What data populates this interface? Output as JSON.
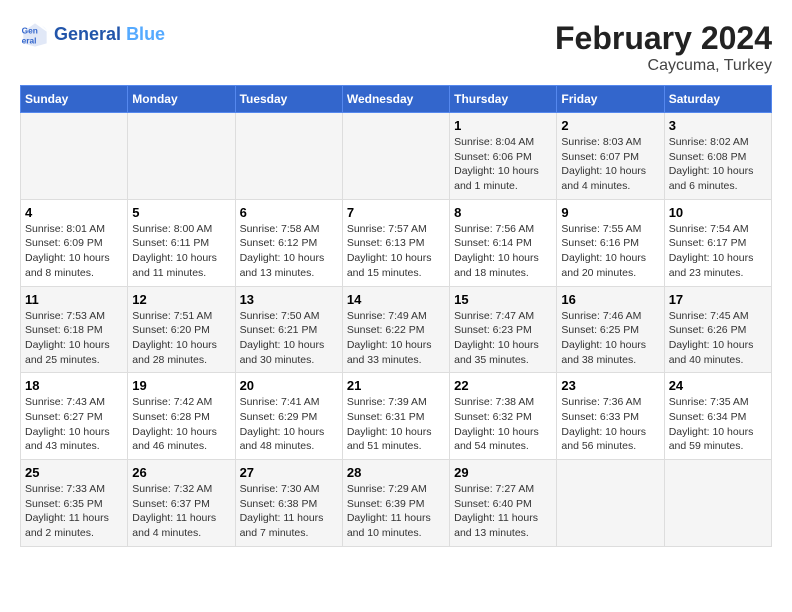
{
  "header": {
    "logo_line1": "General",
    "logo_line2": "Blue",
    "main_title": "February 2024",
    "subtitle": "Caycuma, Turkey"
  },
  "weekdays": [
    "Sunday",
    "Monday",
    "Tuesday",
    "Wednesday",
    "Thursday",
    "Friday",
    "Saturday"
  ],
  "weeks": [
    {
      "row_bg": "odd",
      "days": [
        {
          "num": "",
          "info": ""
        },
        {
          "num": "",
          "info": ""
        },
        {
          "num": "",
          "info": ""
        },
        {
          "num": "",
          "info": ""
        },
        {
          "num": "1",
          "info": "Sunrise: 8:04 AM\nSunset: 6:06 PM\nDaylight: 10 hours\nand 1 minute."
        },
        {
          "num": "2",
          "info": "Sunrise: 8:03 AM\nSunset: 6:07 PM\nDaylight: 10 hours\nand 4 minutes."
        },
        {
          "num": "3",
          "info": "Sunrise: 8:02 AM\nSunset: 6:08 PM\nDaylight: 10 hours\nand 6 minutes."
        }
      ]
    },
    {
      "row_bg": "even",
      "days": [
        {
          "num": "4",
          "info": "Sunrise: 8:01 AM\nSunset: 6:09 PM\nDaylight: 10 hours\nand 8 minutes."
        },
        {
          "num": "5",
          "info": "Sunrise: 8:00 AM\nSunset: 6:11 PM\nDaylight: 10 hours\nand 11 minutes."
        },
        {
          "num": "6",
          "info": "Sunrise: 7:58 AM\nSunset: 6:12 PM\nDaylight: 10 hours\nand 13 minutes."
        },
        {
          "num": "7",
          "info": "Sunrise: 7:57 AM\nSunset: 6:13 PM\nDaylight: 10 hours\nand 15 minutes."
        },
        {
          "num": "8",
          "info": "Sunrise: 7:56 AM\nSunset: 6:14 PM\nDaylight: 10 hours\nand 18 minutes."
        },
        {
          "num": "9",
          "info": "Sunrise: 7:55 AM\nSunset: 6:16 PM\nDaylight: 10 hours\nand 20 minutes."
        },
        {
          "num": "10",
          "info": "Sunrise: 7:54 AM\nSunset: 6:17 PM\nDaylight: 10 hours\nand 23 minutes."
        }
      ]
    },
    {
      "row_bg": "odd",
      "days": [
        {
          "num": "11",
          "info": "Sunrise: 7:53 AM\nSunset: 6:18 PM\nDaylight: 10 hours\nand 25 minutes."
        },
        {
          "num": "12",
          "info": "Sunrise: 7:51 AM\nSunset: 6:20 PM\nDaylight: 10 hours\nand 28 minutes."
        },
        {
          "num": "13",
          "info": "Sunrise: 7:50 AM\nSunset: 6:21 PM\nDaylight: 10 hours\nand 30 minutes."
        },
        {
          "num": "14",
          "info": "Sunrise: 7:49 AM\nSunset: 6:22 PM\nDaylight: 10 hours\nand 33 minutes."
        },
        {
          "num": "15",
          "info": "Sunrise: 7:47 AM\nSunset: 6:23 PM\nDaylight: 10 hours\nand 35 minutes."
        },
        {
          "num": "16",
          "info": "Sunrise: 7:46 AM\nSunset: 6:25 PM\nDaylight: 10 hours\nand 38 minutes."
        },
        {
          "num": "17",
          "info": "Sunrise: 7:45 AM\nSunset: 6:26 PM\nDaylight: 10 hours\nand 40 minutes."
        }
      ]
    },
    {
      "row_bg": "even",
      "days": [
        {
          "num": "18",
          "info": "Sunrise: 7:43 AM\nSunset: 6:27 PM\nDaylight: 10 hours\nand 43 minutes."
        },
        {
          "num": "19",
          "info": "Sunrise: 7:42 AM\nSunset: 6:28 PM\nDaylight: 10 hours\nand 46 minutes."
        },
        {
          "num": "20",
          "info": "Sunrise: 7:41 AM\nSunset: 6:29 PM\nDaylight: 10 hours\nand 48 minutes."
        },
        {
          "num": "21",
          "info": "Sunrise: 7:39 AM\nSunset: 6:31 PM\nDaylight: 10 hours\nand 51 minutes."
        },
        {
          "num": "22",
          "info": "Sunrise: 7:38 AM\nSunset: 6:32 PM\nDaylight: 10 hours\nand 54 minutes."
        },
        {
          "num": "23",
          "info": "Sunrise: 7:36 AM\nSunset: 6:33 PM\nDaylight: 10 hours\nand 56 minutes."
        },
        {
          "num": "24",
          "info": "Sunrise: 7:35 AM\nSunset: 6:34 PM\nDaylight: 10 hours\nand 59 minutes."
        }
      ]
    },
    {
      "row_bg": "odd",
      "days": [
        {
          "num": "25",
          "info": "Sunrise: 7:33 AM\nSunset: 6:35 PM\nDaylight: 11 hours\nand 2 minutes."
        },
        {
          "num": "26",
          "info": "Sunrise: 7:32 AM\nSunset: 6:37 PM\nDaylight: 11 hours\nand 4 minutes."
        },
        {
          "num": "27",
          "info": "Sunrise: 7:30 AM\nSunset: 6:38 PM\nDaylight: 11 hours\nand 7 minutes."
        },
        {
          "num": "28",
          "info": "Sunrise: 7:29 AM\nSunset: 6:39 PM\nDaylight: 11 hours\nand 10 minutes."
        },
        {
          "num": "29",
          "info": "Sunrise: 7:27 AM\nSunset: 6:40 PM\nDaylight: 11 hours\nand 13 minutes."
        },
        {
          "num": "",
          "info": ""
        },
        {
          "num": "",
          "info": ""
        }
      ]
    }
  ]
}
